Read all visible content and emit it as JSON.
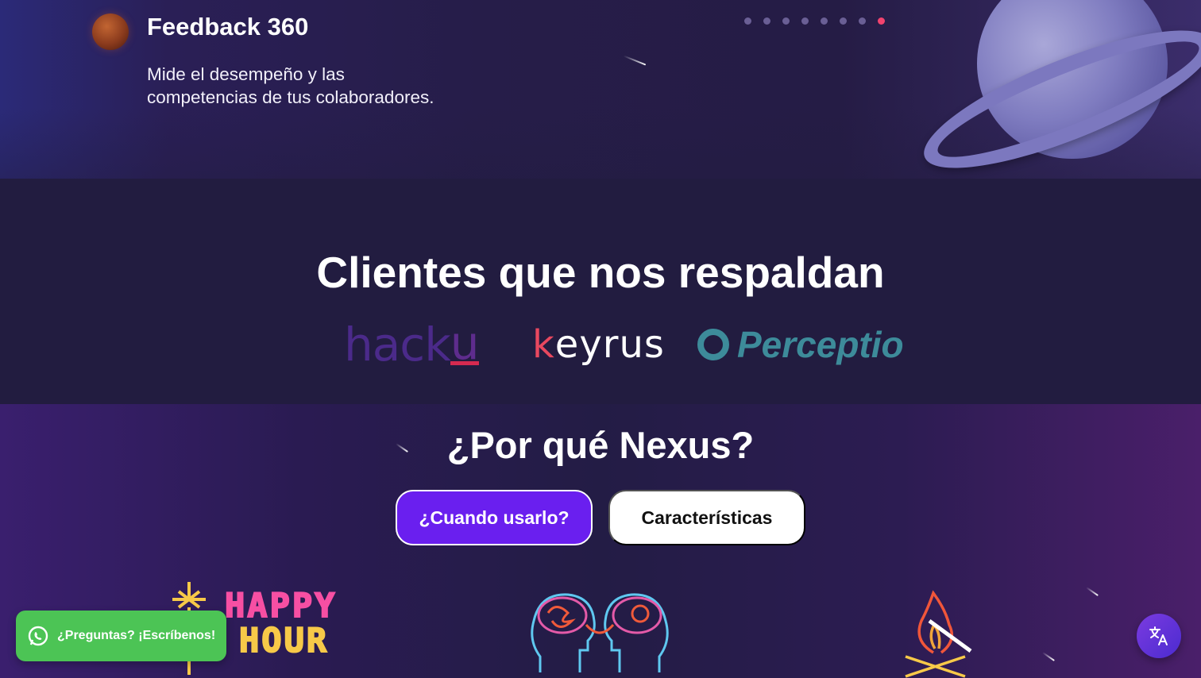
{
  "hero": {
    "title": "Feedback 360",
    "description_line1": "Mide el desempeño y las",
    "description_line2": "competencias de tus colaboradores.",
    "carousel": {
      "total_slides": 8,
      "active_slide": 8
    }
  },
  "clients": {
    "title": "Clientes que nos respaldan",
    "logos": [
      {
        "name": "hacku",
        "text": "hack",
        "accent": "u"
      },
      {
        "name": "keyrus",
        "first": "k",
        "rest": "eyrus"
      },
      {
        "name": "perceptio",
        "text": "Perceptio"
      }
    ]
  },
  "why": {
    "title": "¿Por qué Nexus?",
    "buttons": {
      "when": "¿Cuando usarlo?",
      "features": "Características"
    },
    "illustrations": {
      "happy_hour_line1": "HAPPY",
      "happy_hour_line2": "HOUR"
    }
  },
  "whatsapp": {
    "label": "¿Preguntas? ¡Escríbenos!"
  },
  "icons": {
    "whatsapp": "whatsapp-icon",
    "translate": "translate-icon",
    "planet": "planet-icon",
    "mars": "mars-icon"
  },
  "colors": {
    "background": "#221c40",
    "primary_button": "#6a1fef",
    "active_dot": "#f2436e",
    "whatsapp_green": "#4cc455"
  }
}
